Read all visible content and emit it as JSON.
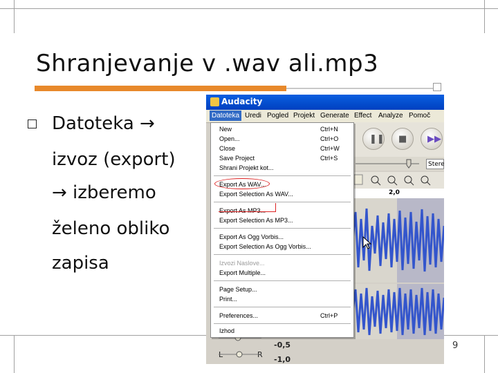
{
  "slide": {
    "title": "Shranjevanje v .wav ali.mp3",
    "body_lines": [
      "Datoteka →",
      "izvoz (export)",
      "→ izberemo",
      "želeno obliko",
      "zapisa"
    ],
    "page_number": "9"
  },
  "colors": {
    "accent": "#e8892b",
    "menu_highlight": "#316ac5",
    "annotation": "#dd2222"
  },
  "app": {
    "title": "Audacity",
    "menu": [
      "Datoteka",
      "Uredi",
      "Pogled",
      "Projekt",
      "Generate",
      "Effect",
      "Analyze",
      "Pomoč"
    ],
    "stereo_label": "Stere",
    "ruler_tick": "2,0",
    "axis_labels": [
      "-0,5",
      "-1,0"
    ],
    "lr_labels": [
      "L",
      "R"
    ],
    "file_menu": {
      "items": [
        {
          "label": "New",
          "shortcut": "Ctrl+N"
        },
        {
          "label": "Open...",
          "shortcut": "Ctrl+O"
        },
        {
          "label": "Close",
          "shortcut": "Ctrl+W"
        },
        {
          "label": "Save Project",
          "shortcut": "Ctrl+S"
        },
        {
          "label": "Shrani Projekt kot...",
          "shortcut": ""
        },
        {
          "label": "Export As WAV...",
          "shortcut": ""
        },
        {
          "label": "Export Selection As WAV...",
          "shortcut": ""
        },
        {
          "label": "Export As MP3...",
          "shortcut": ""
        },
        {
          "label": "Export Selection As MP3...",
          "shortcut": ""
        },
        {
          "label": "Export As Ogg Vorbis...",
          "shortcut": ""
        },
        {
          "label": "Export Selection As Ogg Vorbis...",
          "shortcut": ""
        },
        {
          "label": "Izvozi Naslove...",
          "shortcut": ""
        },
        {
          "label": "Export Multiple...",
          "shortcut": ""
        },
        {
          "label": "Page Setup...",
          "shortcut": ""
        },
        {
          "label": "Print...",
          "shortcut": ""
        },
        {
          "label": "Preferences...",
          "shortcut": "Ctrl+P"
        },
        {
          "label": "Izhod",
          "shortcut": ""
        }
      ]
    }
  }
}
